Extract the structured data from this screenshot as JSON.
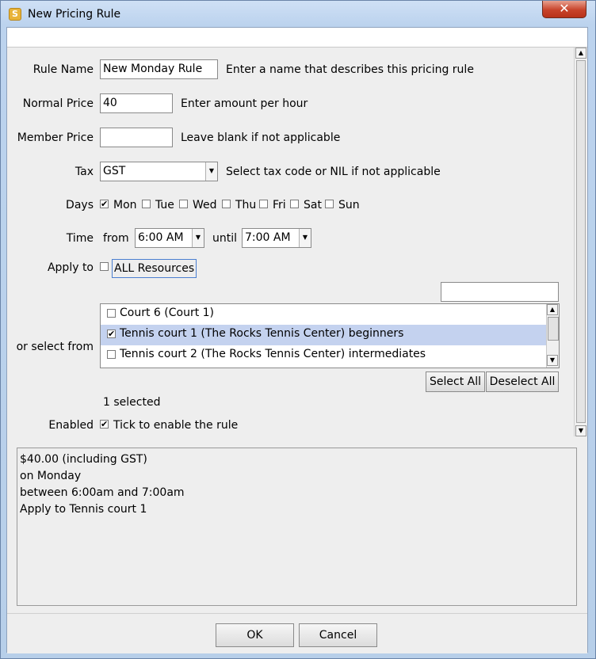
{
  "window": {
    "title": "New Pricing Rule",
    "close_glyph": "✕"
  },
  "form": {
    "rule_name": {
      "label": "Rule Name",
      "value": "New Monday Rule",
      "hint": "Enter a name that describes this pricing rule"
    },
    "normal_price": {
      "label": "Normal Price",
      "value": "40",
      "hint": "Enter amount per hour"
    },
    "member_price": {
      "label": "Member Price",
      "value": "",
      "hint": "Leave blank if not applicable"
    },
    "tax": {
      "label": "Tax",
      "value": "GST",
      "hint": "Select tax code or NIL if not applicable"
    },
    "days": {
      "label": "Days",
      "items": [
        {
          "label": "Mon",
          "checked": true
        },
        {
          "label": "Tue",
          "checked": false
        },
        {
          "label": "Wed",
          "checked": false
        },
        {
          "label": "Thu",
          "checked": false
        },
        {
          "label": "Fri",
          "checked": false
        },
        {
          "label": "Sat",
          "checked": false
        },
        {
          "label": "Sun",
          "checked": false
        }
      ]
    },
    "time": {
      "label": "Time",
      "from_label": "from",
      "from_value": "6:00 AM",
      "until_label": "until",
      "until_value": "7:00 AM"
    },
    "apply_to": {
      "label": "Apply to",
      "all_label": "ALL Resources",
      "all_checked": false
    },
    "resource_search": {
      "value": ""
    },
    "select_from": {
      "label": "or select from",
      "items": [
        {
          "label": "Court 6 (Court 1)",
          "checked": false,
          "selected": false
        },
        {
          "label": "Tennis court 1 (The Rocks Tennis Center) beginners",
          "checked": true,
          "selected": true
        },
        {
          "label": "Tennis court 2 (The Rocks Tennis Center) intermediates",
          "checked": false,
          "selected": false
        }
      ],
      "select_all": "Select All",
      "deselect_all": "Deselect All",
      "count_text": "1 selected"
    },
    "enabled": {
      "label": "Enabled",
      "hint": "Tick to enable the rule",
      "checked": true
    }
  },
  "summary": {
    "lines": [
      "$40.00 (including GST)",
      "on Monday",
      "between 6:00am and 7:00am",
      "Apply to Tennis court 1"
    ]
  },
  "footer": {
    "ok": "OK",
    "cancel": "Cancel"
  },
  "icons": {
    "check": "✔",
    "down": "▼",
    "up": "▲"
  },
  "colors": {
    "selection": "#c4d2ef",
    "close_button": "#c8432b"
  }
}
